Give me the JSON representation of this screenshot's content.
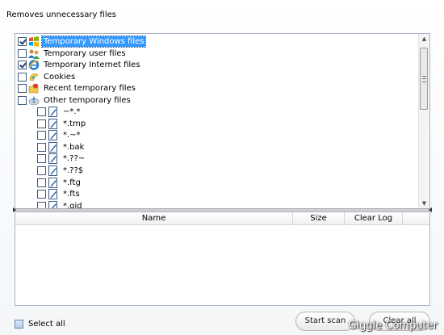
{
  "header": {
    "title": "Removes unnecessary files"
  },
  "tree": {
    "categories": [
      {
        "label": "Temporary Windows files",
        "checked": true,
        "selected": true,
        "icon": "windows-icon"
      },
      {
        "label": "Temporary user files",
        "checked": false,
        "icon": "users-icon"
      },
      {
        "label": "Temporary Internet files",
        "checked": true,
        "icon": "internet-explorer-icon"
      },
      {
        "label": "Cookies",
        "checked": false,
        "icon": "cookie-icon"
      },
      {
        "label": "Recent temporary files",
        "checked": false,
        "icon": "recent-files-icon"
      },
      {
        "label": "Other temporary files",
        "checked": false,
        "icon": "disk-cleanup-icon"
      }
    ],
    "patterns": [
      "~*.*",
      "*.tmp",
      "*.~*",
      "*.bak",
      "*.??~",
      "*.??$",
      "*.ftg",
      "*.fts",
      "*.gid"
    ]
  },
  "table": {
    "columns": [
      "Name",
      "Size",
      "Clear Log"
    ]
  },
  "footer": {
    "select_all": "Select all",
    "start_scan": "Start scan",
    "clear_all": "Clear all",
    "watermark": "Giggle Computer"
  },
  "colors": {
    "selection": "#3399ff",
    "border": "#a9b5c6"
  }
}
